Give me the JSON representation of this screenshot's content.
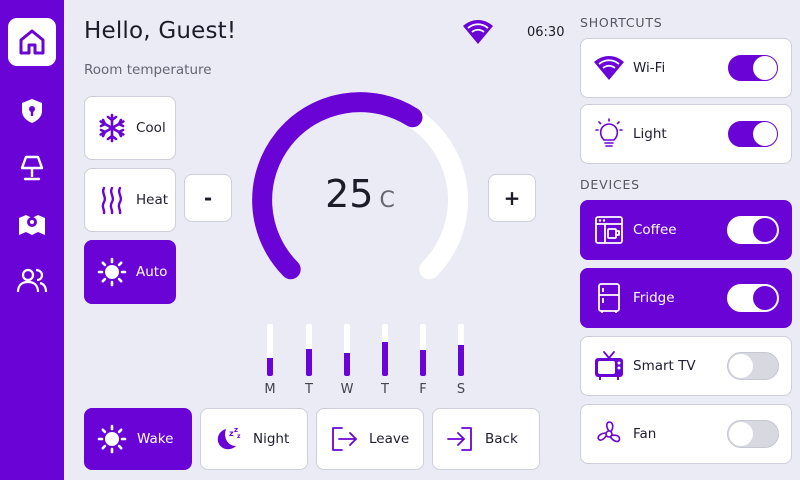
{
  "header": {
    "greeting": "Hello, Guest!",
    "subtitle": "Room temperature",
    "time": "06:30",
    "status_icon": "wifi-icon"
  },
  "nav": {
    "items": [
      "home-icon",
      "security-icon",
      "lamp-icon",
      "location-icon",
      "users-icon"
    ],
    "active": "home-icon"
  },
  "modes": [
    {
      "label": "Cool",
      "icon": "snowflake-icon",
      "active": false
    },
    {
      "label": "Heat",
      "icon": "heat-icon",
      "active": false
    },
    {
      "label": "Auto",
      "icon": "sun-icon",
      "active": true
    }
  ],
  "thermostat": {
    "value": "25",
    "unit": "C",
    "decrease_label": "-",
    "increase_label": "+",
    "level": 0.62
  },
  "weekly": {
    "days": [
      "M",
      "T",
      "W",
      "T",
      "F",
      "S"
    ],
    "levels": [
      0.35,
      0.52,
      0.45,
      0.65,
      0.5,
      0.6
    ]
  },
  "scenes": [
    {
      "label": "Wake",
      "icon": "sun-icon",
      "active": true
    },
    {
      "label": "Night",
      "icon": "moon-sleep-icon",
      "active": false
    },
    {
      "label": "Leave",
      "icon": "exit-icon",
      "active": false
    },
    {
      "label": "Back",
      "icon": "enter-icon",
      "active": false
    }
  ],
  "shortcuts": {
    "title": "SHORTCUTS",
    "items": [
      {
        "label": "Wi-Fi",
        "icon": "wifi-icon",
        "on": true
      },
      {
        "label": "Light",
        "icon": "lightbulb-icon",
        "on": true
      }
    ]
  },
  "devices": {
    "title": "DEVICES",
    "items": [
      {
        "label": "Coffee",
        "icon": "coffee-machine-icon",
        "on": true
      },
      {
        "label": "Fridge",
        "icon": "fridge-icon",
        "on": true
      },
      {
        "label": "Smart TV",
        "icon": "tv-icon",
        "on": false
      },
      {
        "label": "Fan",
        "icon": "fan-icon",
        "on": false
      }
    ]
  },
  "colors": {
    "accent": "#6a04d6",
    "background": "#ebebf5",
    "card": "#ffffff"
  }
}
